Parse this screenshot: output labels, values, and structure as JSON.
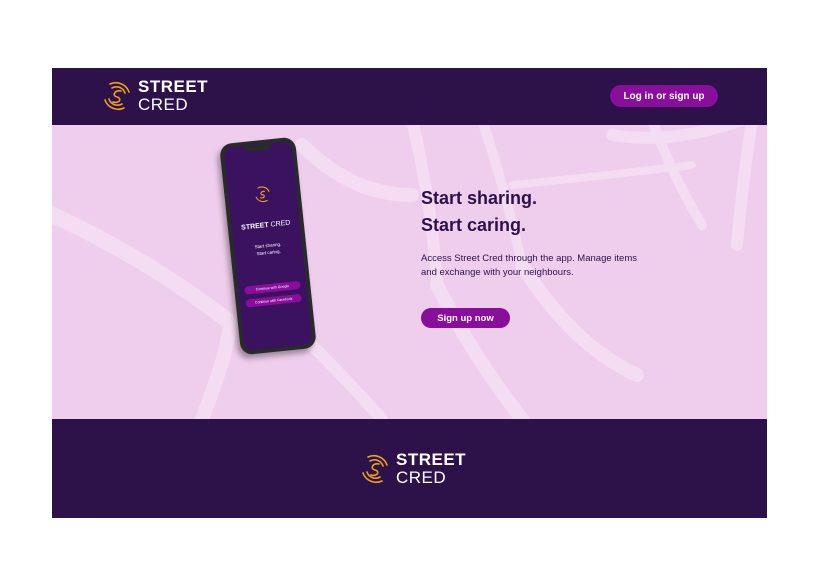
{
  "brand": {
    "name_line1": "STREET",
    "name_line2": "CRED",
    "logo_icon": "street-cred-swirl-icon",
    "colors": {
      "dark_purple": "#2d1249",
      "accent_purple": "#8a0e9c",
      "hero_pink": "#efcdec",
      "logo_orange": "#f0a020"
    }
  },
  "header": {
    "login_label": "Log in or sign up"
  },
  "hero": {
    "headline_line1": "Start sharing.",
    "headline_line2": "Start caring.",
    "description": "Access Street Cred through the app. Manage items and exchange with your neighbours.",
    "cta_label": "Sign up now"
  },
  "phone": {
    "app_name_bold": "STREET",
    "app_name_light": "CRED",
    "tagline_line1": "Start sharing.",
    "tagline_line2": "Start caring.",
    "google_button": "Continue with Google",
    "facebook_button": "Continue with Facebook"
  }
}
